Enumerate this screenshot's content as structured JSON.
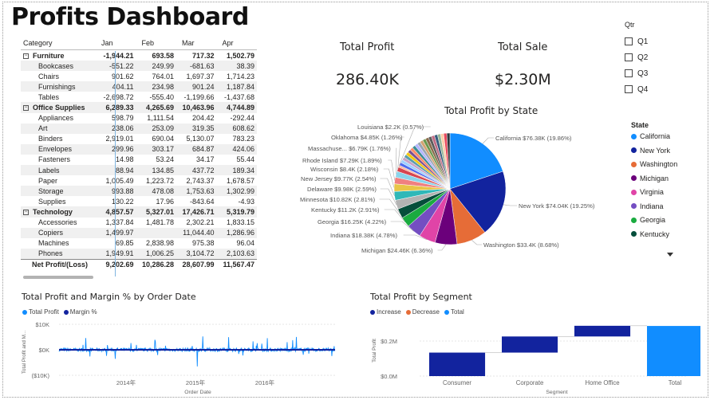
{
  "title": "Profits Dashboard",
  "matrix": {
    "headers": [
      "Category",
      "Jan",
      "Feb",
      "Mar",
      "Apr"
    ],
    "rows": [
      {
        "kind": "cat",
        "label": "Furniture",
        "values": [
          "-1,944.21",
          "693.58",
          "717.32",
          "1,502.79"
        ]
      },
      {
        "kind": "sub",
        "label": "Bookcases",
        "values": [
          "-551.22",
          "249.99",
          "-681.63",
          "38.39"
        ]
      },
      {
        "kind": "sub",
        "label": "Chairs",
        "values": [
          "901.62",
          "764.01",
          "1,697.37",
          "1,714.23"
        ]
      },
      {
        "kind": "sub",
        "label": "Furnishings",
        "values": [
          "404.11",
          "234.98",
          "901.24",
          "1,187.84"
        ]
      },
      {
        "kind": "sub",
        "label": "Tables",
        "values": [
          "-2,698.72",
          "-555.40",
          "-1,199.66",
          "-1,437.68"
        ]
      },
      {
        "kind": "cat",
        "label": "Office Supplies",
        "values": [
          "6,289.33",
          "4,265.69",
          "10,463.96",
          "4,744.89"
        ]
      },
      {
        "kind": "sub",
        "label": "Appliances",
        "values": [
          "598.79",
          "1,111.54",
          "204.42",
          "-292.44"
        ]
      },
      {
        "kind": "sub",
        "label": "Art",
        "values": [
          "238.06",
          "253.09",
          "319.35",
          "608.62"
        ]
      },
      {
        "kind": "sub",
        "label": "Binders",
        "values": [
          "2,919.01",
          "690.04",
          "5,130.07",
          "783.23"
        ]
      },
      {
        "kind": "sub",
        "label": "Envelopes",
        "values": [
          "299.96",
          "303.17",
          "684.87",
          "424.06"
        ]
      },
      {
        "kind": "sub",
        "label": "Fasteners",
        "values": [
          "14.98",
          "53.24",
          "34.17",
          "55.44"
        ]
      },
      {
        "kind": "sub",
        "label": "Labels",
        "values": [
          "88.94",
          "134.85",
          "437.72",
          "189.34"
        ]
      },
      {
        "kind": "sub",
        "label": "Paper",
        "values": [
          "1,005.49",
          "1,223.72",
          "2,743.37",
          "1,678.57"
        ]
      },
      {
        "kind": "sub",
        "label": "Storage",
        "values": [
          "993.88",
          "478.08",
          "1,753.63",
          "1,302.99"
        ]
      },
      {
        "kind": "sub",
        "label": "Supplies",
        "values": [
          "130.22",
          "17.96",
          "-843.64",
          "-4.93"
        ]
      },
      {
        "kind": "cat",
        "label": "Technology",
        "values": [
          "4,857.57",
          "5,327.01",
          "17,426.71",
          "5,319.79"
        ]
      },
      {
        "kind": "sub",
        "label": "Accessories",
        "values": [
          "1,337.84",
          "1,481.78",
          "2,302.21",
          "1,833.15"
        ]
      },
      {
        "kind": "sub",
        "label": "Copiers",
        "values": [
          "1,499.97",
          "",
          "11,044.40",
          "1,286.96"
        ]
      },
      {
        "kind": "sub",
        "label": "Machines",
        "values": [
          "69.85",
          "2,838.98",
          "975.38",
          "96.04"
        ]
      },
      {
        "kind": "sub",
        "label": "Phones",
        "values": [
          "1,949.91",
          "1,006.25",
          "3,104.72",
          "2,103.63"
        ]
      },
      {
        "kind": "total",
        "label": "Net Profit/(Loss)",
        "values": [
          "9,202.69",
          "10,286.28",
          "28,607.99",
          "11,567.47"
        ]
      }
    ]
  },
  "cards": {
    "total_profit_label": "Total Profit",
    "total_profit_value": "286.40K",
    "total_sale_label": "Total Sale",
    "total_sale_value": "$2.30M"
  },
  "slicer": {
    "title": "Qtr",
    "items": [
      "Q1",
      "Q2",
      "Q3",
      "Q4"
    ]
  },
  "icons": {
    "expander": "collapse-minus-icon",
    "checkbox": "checkbox-icon",
    "legend_more": "chevron-down-icon"
  },
  "pie": {
    "title": "Total Profit by State",
    "legend_title": "State",
    "legend": [
      {
        "name": "California",
        "color": "#118DFF"
      },
      {
        "name": "New York",
        "color": "#12239E"
      },
      {
        "name": "Washington",
        "color": "#E66C37"
      },
      {
        "name": "Michigan",
        "color": "#6B007B"
      },
      {
        "name": "Virginia",
        "color": "#E044A7"
      },
      {
        "name": "Indiana",
        "color": "#744EC2"
      },
      {
        "name": "Georgia",
        "color": "#1AAB40"
      },
      {
        "name": "Kentucky",
        "color": "#054E3B"
      }
    ]
  },
  "chart_data": [
    {
      "type": "pie",
      "title": "Total Profit by State",
      "legend_title": "State",
      "slices": [
        {
          "label": "California $76.38K (19.86%)",
          "name": "California",
          "value": 76.38,
          "color": "#118DFF"
        },
        {
          "label": "New York $74.04K (19.25%)",
          "name": "New York",
          "value": 74.04,
          "color": "#12239E"
        },
        {
          "label": "Washington $33.4K (8.68%)",
          "name": "Washington",
          "value": 33.4,
          "color": "#E66C37"
        },
        {
          "label": "Michigan $24.46K (6.36%)",
          "name": "Michigan",
          "value": 24.46,
          "color": "#6B007B"
        },
        {
          "label": "Indiana $18.38K (4.78%)",
          "name": "Indiana",
          "value": 18.38,
          "color": "#E044A7"
        },
        {
          "label": "Georgia $16.25K (4.22%)",
          "name": "Georgia",
          "value": 16.25,
          "color": "#744EC2"
        },
        {
          "label": "Kentucky $11.2K (2.91%)",
          "name": "Kentucky",
          "value": 11.2,
          "color": "#1AAB40"
        },
        {
          "label": "Minnesota $10.82K (2.81%)",
          "name": "Minnesota",
          "value": 10.82,
          "color": "#054E3B"
        },
        {
          "label": "Delaware $9.98K (2.59%)",
          "name": "Delaware",
          "value": 9.98,
          "color": "#B3B3B3"
        },
        {
          "label": "New Jersey $9.77K (2.54%)",
          "name": "New Jersey",
          "value": 9.77,
          "color": "#2FB8B8"
        },
        {
          "label": "Wisconsin $8.4K (2.18%)",
          "name": "Wisconsin",
          "value": 8.4,
          "color": "#E8C547"
        },
        {
          "label": "Rhode Island $7.29K (1.89%)",
          "name": "Rhode Island",
          "value": 7.29,
          "color": "#F08080"
        },
        {
          "label": "Massachuse... $6.79K (1.76%)",
          "name": "Massachusetts",
          "value": 6.79,
          "color": "#8AD4EB"
        },
        {
          "label": "Oklahoma $4.85K (1.26%)",
          "name": "Oklahoma",
          "value": 4.85,
          "color": "#D64550"
        },
        {
          "label": "Louisiana $2.2K (0.57%)",
          "name": "Louisiana",
          "value": 2.2,
          "color": "#FEB8A0"
        }
      ],
      "other_value": 69.19
    },
    {
      "type": "line",
      "title": "Total Profit and Margin % by Order Date",
      "xlabel": "Order Date",
      "ylabel": "Total Profit and M...",
      "legend": [
        {
          "name": "Total Profit",
          "color": "#118DFF"
        },
        {
          "name": "Margin %",
          "color": "#12239E"
        }
      ],
      "y_ticks": [
        "$10K",
        "$0K",
        "($10K)"
      ],
      "ylim": [
        -10000,
        10000
      ],
      "x_ticks": [
        "2014年",
        "2015年",
        "2016年"
      ]
    },
    {
      "type": "bar",
      "subtype": "waterfall",
      "title": "Total Profit by Segment",
      "xlabel": "Segment",
      "ylabel": "Total Profit",
      "legend": [
        {
          "name": "Increase",
          "color": "#12239E"
        },
        {
          "name": "Decrease",
          "color": "#E66C37"
        },
        {
          "name": "Total",
          "color": "#118DFF"
        }
      ],
      "categories": [
        "Consumer",
        "Corporate",
        "Home Office",
        "Total"
      ],
      "values": [
        0.134,
        0.092,
        0.061,
        0.286
      ],
      "y_ticks": [
        "$0.2M",
        "$0.0M"
      ],
      "ylim": [
        0,
        0.3
      ]
    }
  ]
}
